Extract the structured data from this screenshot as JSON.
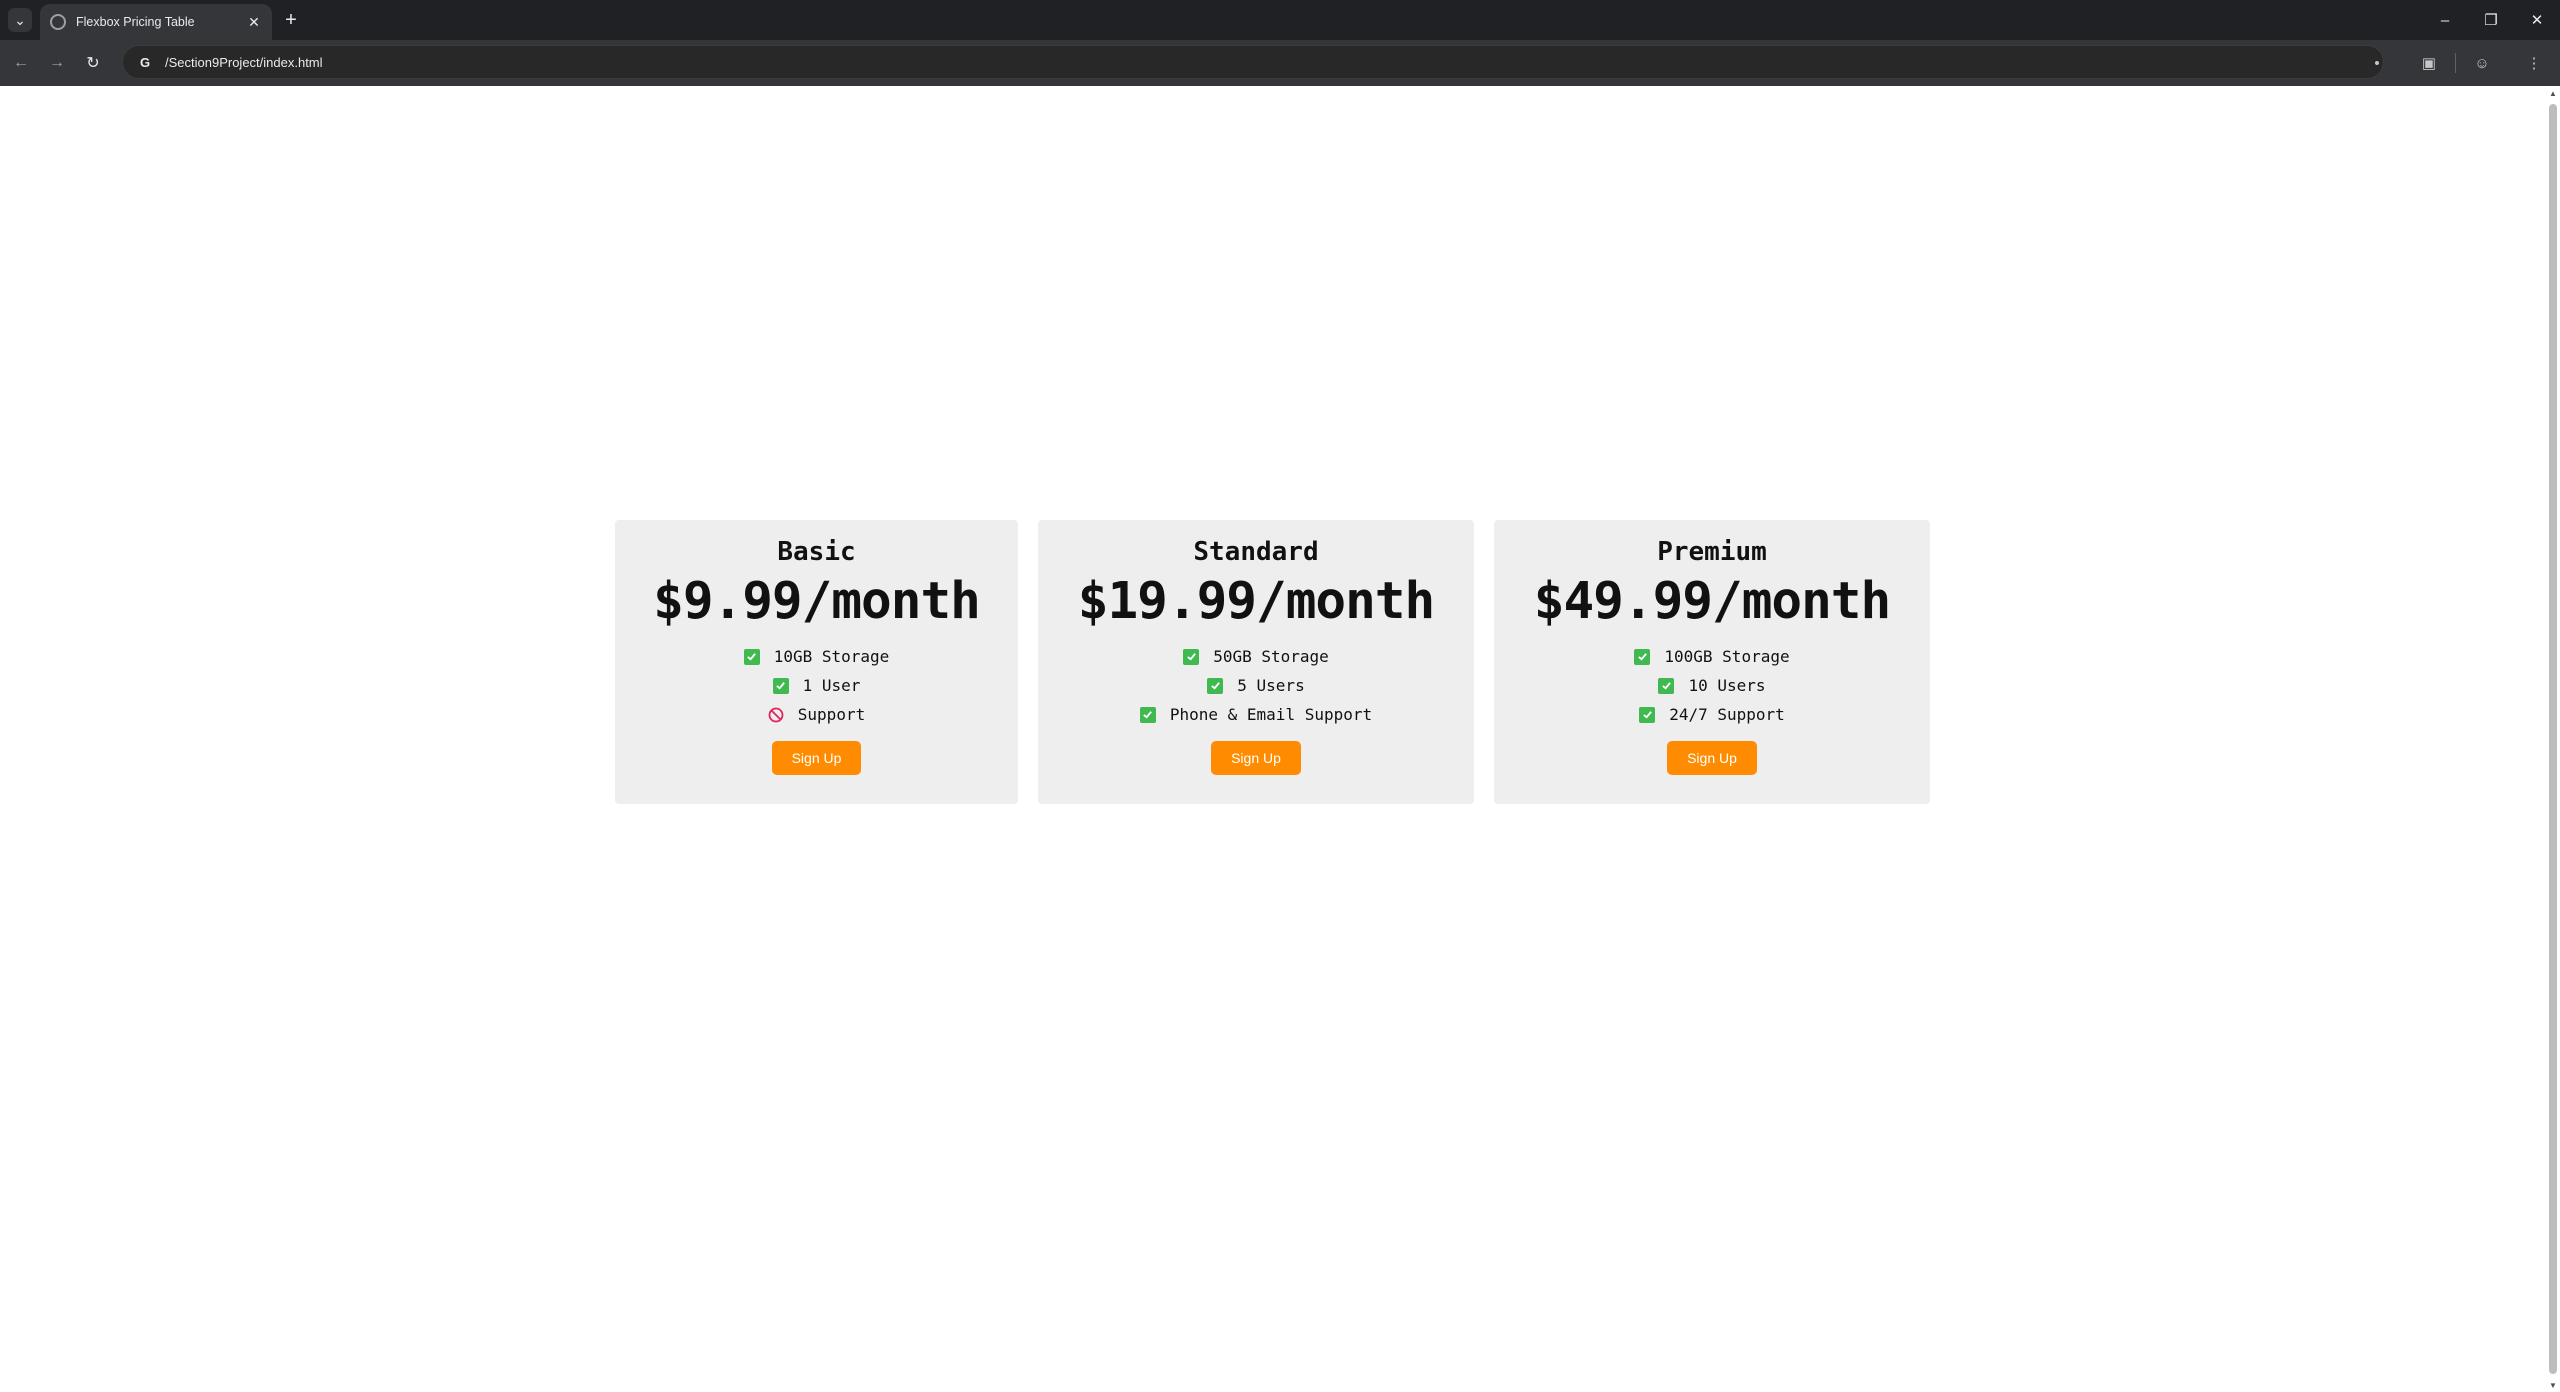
{
  "browser": {
    "tab_title": "Flexbox Pricing Table",
    "url": "/Section9Project/index.html"
  },
  "plans": [
    {
      "name": "Basic",
      "price": "$9.99/month",
      "features": [
        {
          "text": "10GB Storage",
          "included": true
        },
        {
          "text": "1 User",
          "included": true
        },
        {
          "text": "Support",
          "included": false
        }
      ],
      "button": "Sign Up"
    },
    {
      "name": "Standard",
      "price": "$19.99/month",
      "features": [
        {
          "text": "50GB Storage",
          "included": true
        },
        {
          "text": "5 Users",
          "included": true
        },
        {
          "text": "Phone & Email Support",
          "included": true
        }
      ],
      "button": "Sign Up"
    },
    {
      "name": "Premium",
      "price": "$49.99/month",
      "features": [
        {
          "text": "100GB Storage",
          "included": true
        },
        {
          "text": "10 Users",
          "included": true
        },
        {
          "text": "24/7 Support",
          "included": true
        }
      ],
      "button": "Sign Up"
    }
  ],
  "colors": {
    "accent": "#ff8c00",
    "check": "#3fb950",
    "no": "#e0245e",
    "card_bg": "#eeeeee"
  }
}
